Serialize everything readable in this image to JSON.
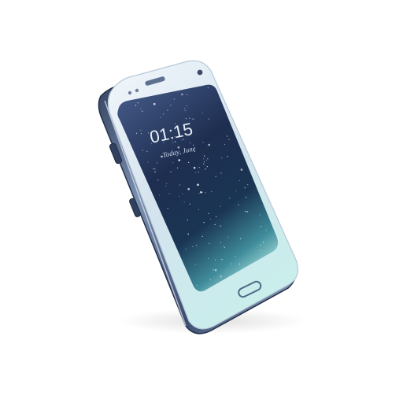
{
  "photo": {
    "subject": "smartphone",
    "background_color": "#ffffff"
  },
  "phone": {
    "colors": {
      "frame": "#3b4c6e",
      "frame_highlight": "#d9e4f2",
      "bezel": "#d7e8f3",
      "screen_top": "#34476f",
      "screen_mid": "#1b2a48",
      "screen_bottom": "#a8e3e2"
    },
    "screen": {
      "clock_text": "01:15",
      "date_text": "Today, June"
    }
  }
}
